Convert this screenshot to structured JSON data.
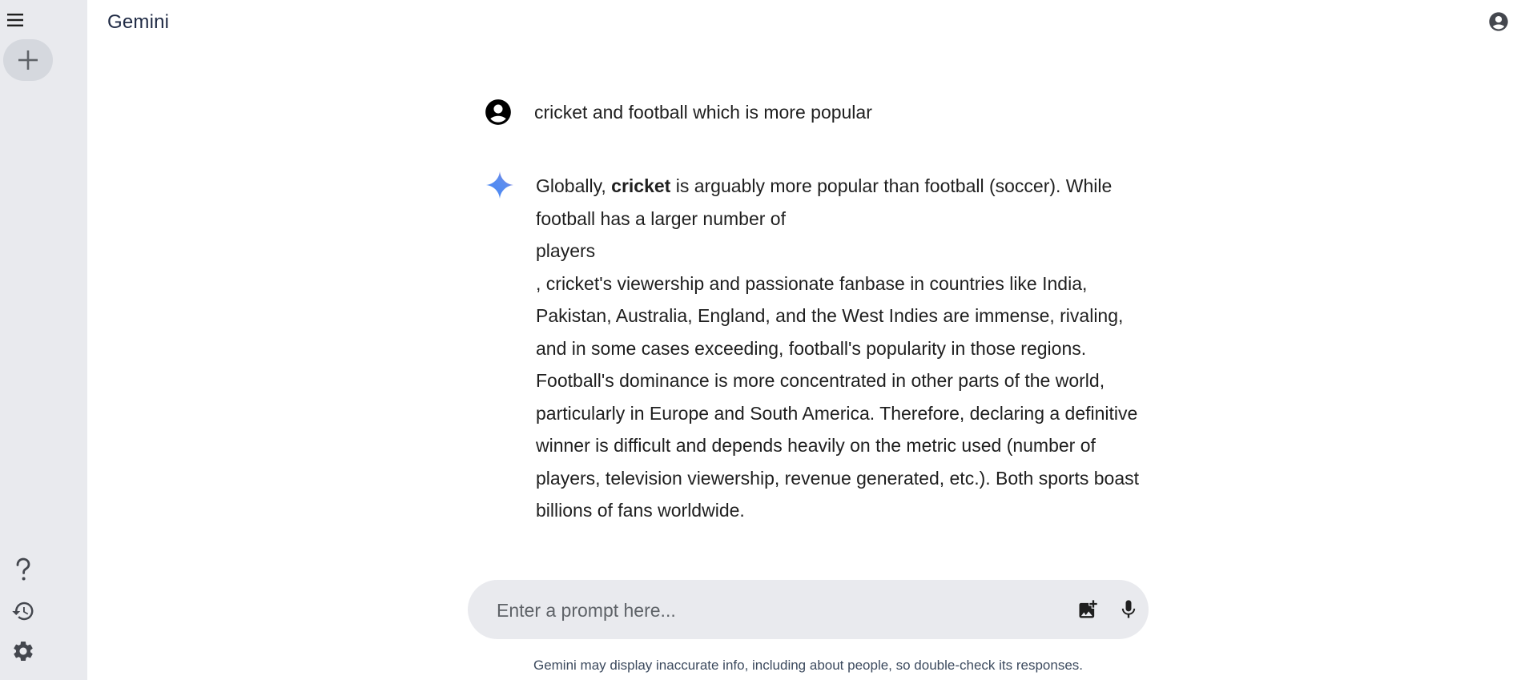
{
  "app": {
    "title": "Gemini"
  },
  "sidebar": {
    "icons": {
      "menu": "menu-icon",
      "new_chat": "plus-icon",
      "help": "help-icon",
      "activity": "history-icon",
      "settings": "gear-icon"
    }
  },
  "header": {
    "profile_icon": "account-circle-icon"
  },
  "conversation": {
    "user_query": "cricket and football which is more popular",
    "response": {
      "intro": "Globally, ",
      "bold_term": "cricket",
      "after_bold": " is arguably more popular than football (soccer). While football has a larger number of",
      "emphasis": "players",
      "rest": ", cricket's viewership and passionate fanbase in countries like India, Pakistan, Australia, England, and the West Indies are immense, rivaling, and in some cases exceeding, football's popularity in those regions. Football's dominance is more concentrated in other parts of the world, particularly in Europe and South America. Therefore, declaring a definitive winner is difficult and depends heavily on the metric used (number of players, television viewership, revenue generated, etc.). Both sports boast billions of fans worldwide."
    }
  },
  "prompt": {
    "placeholder": "Enter a prompt here...",
    "value": "",
    "icons": {
      "image": "add-image-icon",
      "mic": "microphone-icon"
    }
  },
  "footer": {
    "disclaimer": "Gemini may display inaccurate info, including about people, so double-check its responses."
  },
  "colors": {
    "sidebar_bg": "#e9eaee",
    "new_chat_bg": "#d5d8de",
    "prompt_bg": "#e9eaee",
    "spark_blue": "#4285f4",
    "spark_purple": "#9b72cb"
  }
}
